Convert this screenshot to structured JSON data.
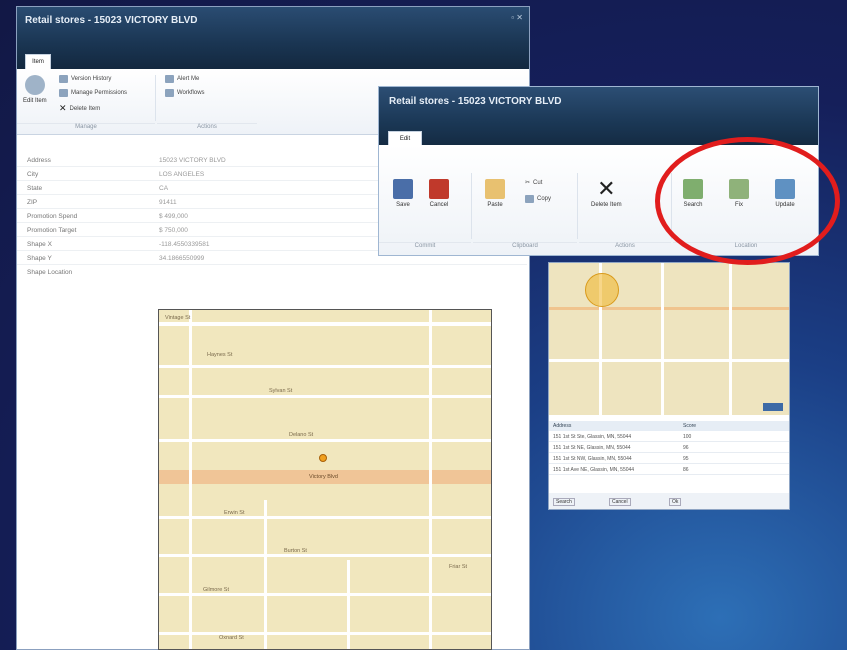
{
  "bg_window": {
    "title": "Retail stores - 15023 VICTORY BLVD",
    "tab": "Item",
    "save_label": "Edit Item",
    "manage_buttons": [
      "Version History",
      "Manage Permissions",
      "Delete Item"
    ],
    "actions_buttons": [
      "Alert Me",
      "Workflows"
    ],
    "group_manage": "Manage",
    "group_actions": "Actions",
    "fields": [
      {
        "label": "Address",
        "value": "15023 VICTORY BLVD"
      },
      {
        "label": "City",
        "value": "LOS ANGELES"
      },
      {
        "label": "State",
        "value": "CA"
      },
      {
        "label": "ZIP",
        "value": "91411"
      },
      {
        "label": "Promotion Spend",
        "value": "$ 499,000"
      },
      {
        "label": "Promotion Target",
        "value": "$ 750,000"
      },
      {
        "label": "Shape X",
        "value": "-118.4550339581"
      },
      {
        "label": "Shape Y",
        "value": "34.1866550999"
      },
      {
        "label": "Shape Location",
        "value": ""
      }
    ],
    "streets": [
      "Vintage St",
      "Haynes St",
      "Sylvan St",
      "Delano St",
      "Victory Blvd",
      "Erwin St",
      "Burton St",
      "Friar St",
      "Gilmore St",
      "Oxnard St"
    ]
  },
  "fg_window": {
    "title": "Retail stores - 15023 VICTORY BLVD",
    "tab": "Edit",
    "buttons": [
      {
        "label": "Save",
        "icon": "save-icon"
      },
      {
        "label": "Cancel",
        "icon": "cancel-icon"
      },
      {
        "label": "Paste",
        "icon": "paste-icon"
      },
      {
        "label": "Delete Item",
        "icon": "delete-icon"
      },
      {
        "label": "Search",
        "icon": "search-location-icon"
      },
      {
        "label": "Fix",
        "icon": "fix-location-icon"
      },
      {
        "label": "Update",
        "icon": "update-location-icon"
      }
    ],
    "small_buttons": [
      "Cut",
      "Copy"
    ],
    "groups": [
      "Commit",
      "Clipboard",
      "Actions",
      "Location"
    ]
  },
  "result_panel": {
    "columns": [
      "Address",
      "Score"
    ],
    "rows": [
      {
        "address": "151 1st St Ste, Glassin, MN, 55044",
        "score": "100"
      },
      {
        "address": "151 1st St NE, Glassin, MN, 55044",
        "score": "96"
      },
      {
        "address": "151 1st St NW, Glassin, MN, 55044",
        "score": "95"
      },
      {
        "address": "151 1st Ave NE, Glassin, MN, 55044",
        "score": "86"
      }
    ],
    "footer_buttons": [
      "Search",
      "Cancel",
      "Ok"
    ]
  },
  "colors": {
    "accent_oval": "#e11d1d",
    "titlebar": "#1b3856",
    "map_bg": "#f1e7be"
  }
}
